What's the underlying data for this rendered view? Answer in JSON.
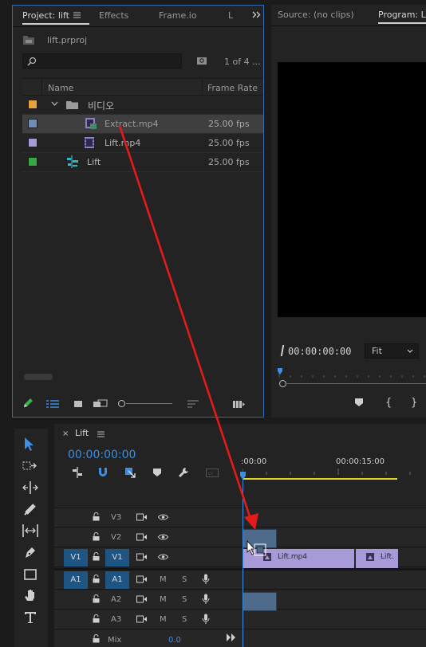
{
  "project_panel": {
    "tabs": [
      "Project: lift",
      "Effects",
      "Frame.io",
      "L"
    ],
    "project_file": "lift.prproj",
    "item_count": "1 of 4 ...",
    "search_placeholder": "",
    "columns": {
      "name": "Name",
      "frame_rate": "Frame Rate"
    },
    "items": [
      {
        "name": "비디오",
        "frame_rate": "",
        "swatch": "#e6a23c",
        "type": "bin"
      },
      {
        "name": "Extract.mp4",
        "frame_rate": "25.00 fps",
        "swatch": "#6f8fb8",
        "type": "clip"
      },
      {
        "name": "Lift.mp4",
        "frame_rate": "25.00 fps",
        "swatch": "#a89ad8",
        "type": "clip"
      },
      {
        "name": "Lift",
        "frame_rate": "25.00 fps",
        "swatch": "#38a844",
        "type": "sequence"
      }
    ]
  },
  "source_monitor": {
    "tab": "Source: (no clips)"
  },
  "program_monitor": {
    "tab": "Program: Lif",
    "timecode": "00:00:00:00",
    "fit": "Fit"
  },
  "timeline": {
    "sequence_name": "Lift",
    "timecode": "00:00:00:00",
    "ruler_labels": [
      ":00:00",
      "00:00:15:00"
    ],
    "video_tracks": [
      {
        "name": "V3",
        "source": ""
      },
      {
        "name": "V2",
        "source": ""
      },
      {
        "name": "V1",
        "source": "V1"
      }
    ],
    "audio_tracks": [
      {
        "name": "A1",
        "source": "A1",
        "m": "M",
        "s": "S"
      },
      {
        "name": "A2",
        "source": "",
        "m": "M",
        "s": "S"
      },
      {
        "name": "A3",
        "source": "",
        "m": "M",
        "s": "S"
      }
    ],
    "mix": {
      "label": "Mix",
      "value": "0.0"
    },
    "clips": [
      {
        "name": "Lift.mp4"
      },
      {
        "name": "Lift."
      }
    ]
  },
  "colors": {
    "accent": "#2d8ceb",
    "playhead": "#3d8ee5",
    "video_clip": "#a899d7",
    "dragged_clip": "#4f6b8b",
    "arrow": "#e31b1b",
    "work_area": "#e4d52a"
  },
  "icons": [
    "panel-menu-icon",
    "expand-panels-icon",
    "project-file-icon",
    "search-icon",
    "new-search-bin-icon",
    "chevron-down-icon",
    "folder-icon",
    "video-clip-icon",
    "sequence-icon",
    "pencil-icon",
    "list-view-icon",
    "icon-view-icon",
    "freeform-view-icon",
    "zoom-slider",
    "sort-icon",
    "automate-icon",
    "selection-tool-icon",
    "track-select-tool-icon",
    "ripple-edit-tool-icon",
    "razor-tool-icon",
    "slip-tool-icon",
    "pen-tool-icon",
    "rectangle-tool-icon",
    "hand-tool-icon",
    "type-tool-icon",
    "lock-icon",
    "camera-icon",
    "eye-icon",
    "microphone-icon",
    "snap-icon",
    "linked-selection-icon",
    "marker-icon",
    "wrench-icon",
    "captions-icon"
  ]
}
